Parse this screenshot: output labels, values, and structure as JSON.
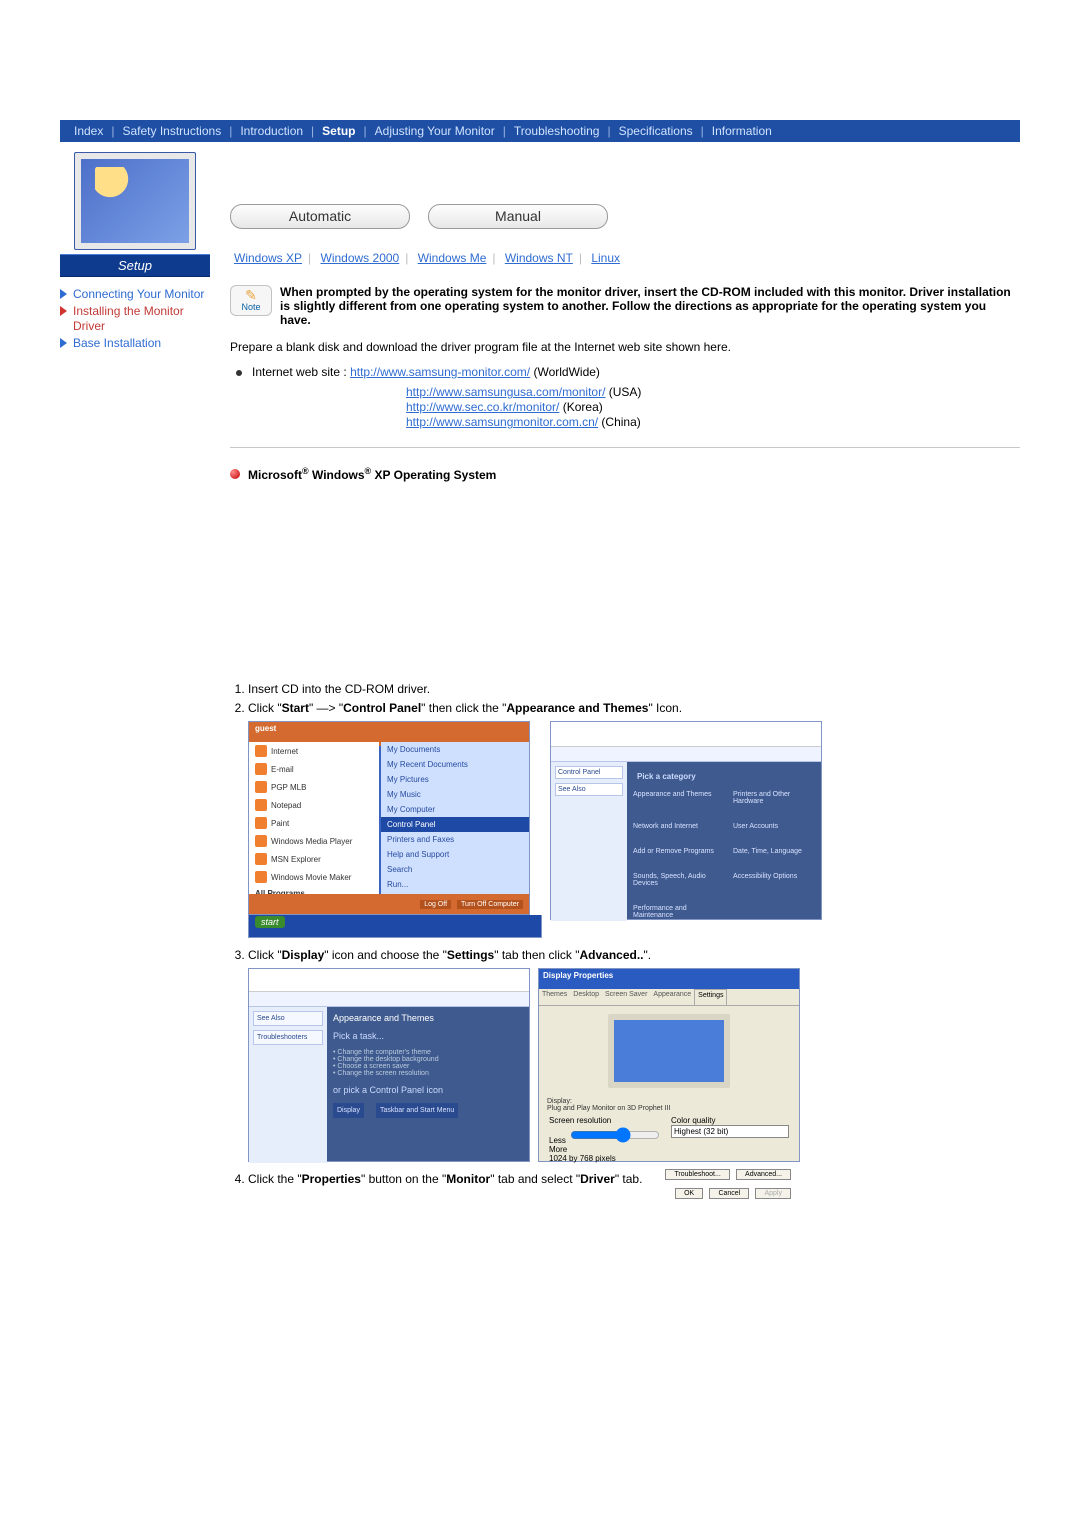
{
  "topnav": {
    "items": [
      "Index",
      "Safety Instructions",
      "Introduction",
      "Setup",
      "Adjusting Your Monitor",
      "Troubleshooting",
      "Specifications",
      "Information"
    ],
    "active": "Setup"
  },
  "sidebar": {
    "setup_label": "Setup",
    "items": [
      {
        "label": "Connecting Your Monitor",
        "kind": "blue"
      },
      {
        "label": "Installing the Monitor Driver",
        "kind": "red"
      },
      {
        "label": "Base Installation",
        "kind": "blue"
      }
    ]
  },
  "tabs": {
    "automatic": "Automatic",
    "manual": "Manual"
  },
  "os_row": {
    "items": [
      "Windows XP",
      "Windows 2000",
      "Windows Me",
      "Windows NT",
      "Linux"
    ]
  },
  "note": {
    "icon_label": "Note",
    "text": "When prompted by the operating system for the monitor driver, insert the CD-ROM included with this monitor. Driver installation is slightly different from one operating system to another. Follow the directions as appropriate for the operating system you have."
  },
  "prepare_text": "Prepare a blank disk and download the driver program file at the Internet web site shown here.",
  "site_lead": "Internet web site : ",
  "sites": [
    {
      "url": "http://www.samsung-monitor.com/",
      "region": " (WorldWide)"
    },
    {
      "url": "http://www.samsungusa.com/monitor/",
      "region": " (USA)"
    },
    {
      "url": "http://www.sec.co.kr/monitor/",
      "region": " (Korea)"
    },
    {
      "url": "http://www.samsungmonitor.com.cn/",
      "region": " (China)"
    }
  ],
  "os_heading": {
    "prefix": "Microsoft",
    "mid": " Windows",
    "suffix": " XP Operating System",
    "reg": "®"
  },
  "steps": {
    "s1": "Insert CD into the CD-ROM driver.",
    "s2_a": "Click \"",
    "s2_start": "Start",
    "s2_b": "\" —> \"",
    "s2_cp": "Control Panel",
    "s2_c": "\" then click the \"",
    "s2_at": "Appearance and Themes",
    "s2_d": "\" Icon.",
    "s3_a": "Click \"",
    "s3_display": "Display",
    "s3_b": "\" icon and choose the \"",
    "s3_settings": "Settings",
    "s3_c": "\" tab then click \"",
    "s3_adv": "Advanced..",
    "s3_d": "\".",
    "s4_a": "Click the \"",
    "s4_prop": "Properties",
    "s4_b": "\" button on the \"",
    "s4_mon": "Monitor",
    "s4_c": "\" tab and select \"",
    "s4_drv": "Driver",
    "s4_d": "\" tab."
  },
  "mock": {
    "start_title": "guest",
    "start_left": [
      "Internet",
      "E-mail",
      "PGP MLB",
      "Notepad",
      "Paint",
      "Windows Media Player",
      "MSN Explorer",
      "Windows Movie Maker",
      "All Programs"
    ],
    "start_right": [
      "My Documents",
      "My Recent Documents",
      "My Pictures",
      "My Music",
      "My Computer",
      "Control Panel",
      "Printers and Faxes",
      "Help and Support",
      "Search",
      "Run..."
    ],
    "start_right_hl": "Control Panel",
    "footer_logoff": "Log Off",
    "footer_turnoff": "Turn Off Computer",
    "start_bottom": "start",
    "cp_cat": "Pick a category",
    "cp_items": [
      "Appearance and Themes",
      "Printers and Other Hardware",
      "Network and Internet",
      "User Accounts",
      "Add or Remove Programs",
      "Date, Time, Language",
      "Sounds, Speech, Audio Devices",
      "Accessibility Options",
      "Performance and Maintenance"
    ],
    "cp2_task": "Pick a task...",
    "cp2_or": "or pick a Control Panel icon",
    "dp_title": "Display Properties",
    "dp_tabs": [
      "Themes",
      "Desktop",
      "Screen Saver",
      "Appearance",
      "Settings"
    ],
    "dp_active_tab": "Settings",
    "dp_display_label": "Display:",
    "dp_display_val": "Plug and Play Monitor on 3D Prophet III",
    "dp_res_label": "Screen resolution",
    "dp_res_less": "Less",
    "dp_res_more": "More",
    "dp_res_val": "1024 by 768 pixels",
    "dp_cq_label": "Color quality",
    "dp_cq_val": "Highest (32 bit)",
    "dp_btn_trouble": "Troubleshoot...",
    "dp_btn_adv": "Advanced...",
    "dp_ok": "OK",
    "dp_cancel": "Cancel",
    "dp_apply": "Apply"
  }
}
